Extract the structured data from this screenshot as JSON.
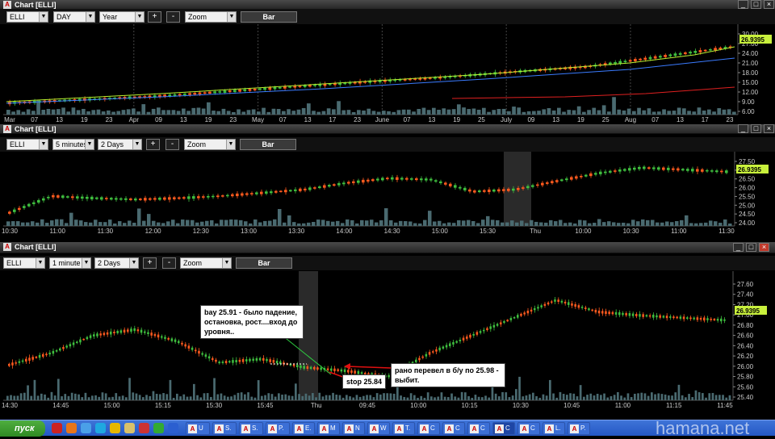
{
  "windows": [
    {
      "title": "Chart [ELLI]",
      "symbol": "ELLI",
      "interval": "DAY",
      "range": "Year",
      "zoom": "Zoom",
      "bar_label": "Bar",
      "plus": "+",
      "minus": "-",
      "price_label": "26.9395",
      "y_ticks": [
        "30.00",
        "27.00",
        "24.00",
        "21.00",
        "18.00",
        "15.00",
        "12.00",
        "9.00",
        "6.00"
      ],
      "x_ticks": [
        "Mar",
        "07",
        "13",
        "19",
        "23",
        "Apr",
        "09",
        "13",
        "19",
        "23",
        "May",
        "07",
        "13",
        "17",
        "23",
        "June",
        "07",
        "13",
        "19",
        "25",
        "July",
        "09",
        "13",
        "19",
        "25",
        "Aug",
        "07",
        "13",
        "17",
        "23"
      ]
    },
    {
      "title": "Chart [ELLI]",
      "symbol": "ELLI",
      "interval": "5 minutes",
      "range": "2 Days",
      "zoom": "Zoom",
      "bar_label": "Bar",
      "plus": "+",
      "minus": "-",
      "price_label": "26.9395",
      "y_ticks": [
        "27.50",
        "27.00",
        "26.50",
        "26.00",
        "25.50",
        "25.00",
        "24.50",
        "24.00"
      ],
      "x_ticks": [
        "10:30",
        "11:00",
        "11:30",
        "12:00",
        "12:30",
        "13:00",
        "13:30",
        "14:00",
        "14:30",
        "15:00",
        "15:30",
        "Thu",
        "10:00",
        "10:30",
        "11:00",
        "11:30"
      ]
    },
    {
      "title": "Chart [ELLI]",
      "symbol": "ELLI",
      "interval": "1 minute",
      "range": "2 Days",
      "zoom": "Zoom",
      "bar_label": "Bar",
      "plus": "+",
      "minus": "-",
      "price_label": "26.9395",
      "y_ticks": [
        "27.60",
        "27.40",
        "27.20",
        "27.00",
        "26.80",
        "26.60",
        "26.40",
        "26.20",
        "26.00",
        "25.80",
        "25.60",
        "25.40"
      ],
      "x_ticks": [
        "14:30",
        "14:45",
        "15:00",
        "15:15",
        "15:30",
        "15:45",
        "Thu",
        "09:45",
        "10:00",
        "10:15",
        "10:30",
        "10:45",
        "11:00",
        "11:15",
        "11:45"
      ]
    }
  ],
  "annotations": {
    "buy_note": "bay 25.91 - было падение, остановка, рост....вход до уровня..",
    "stop_note": "stop 25.84",
    "be_note": "рано перевел в б/у по 25.98 - выбит."
  },
  "taskbar": {
    "start": "пуск",
    "items": [
      "U",
      "S.",
      "S.",
      "P.",
      "E.",
      "M",
      "N",
      "W",
      "T.",
      "C",
      "C",
      "C",
      "C",
      "C",
      "L.",
      "P."
    ],
    "active_index": 12
  },
  "watermark": "hamana.net",
  "colors": {
    "up": "#3fbf3f",
    "down": "#ff5a1e",
    "ma_fast": "#b8f030",
    "ma_mid": "#3a7bff",
    "ma_slow": "#e02020",
    "volume": "#4a6a70",
    "price_tag": "#c8f03c"
  },
  "chart_data": [
    {
      "type": "candlestick",
      "title": "Chart [ELLI] DAY Year",
      "x_ticks": [
        "Mar",
        "Apr",
        "May",
        "June",
        "July",
        "Aug"
      ],
      "ylim": [
        6,
        30
      ],
      "last": 26.9395
    },
    {
      "type": "candlestick",
      "title": "Chart [ELLI] 5 minutes 2 Days",
      "ylim": [
        24,
        27.5
      ],
      "last": 26.9395
    },
    {
      "type": "candlestick",
      "title": "Chart [ELLI] 1 minute 2 Days",
      "ylim": [
        25.4,
        27.6
      ],
      "last": 26.9395,
      "annotations": [
        {
          "label": "bay",
          "value": 25.91
        },
        {
          "label": "stop",
          "value": 25.84
        },
        {
          "label": "б/у",
          "value": 25.98
        }
      ]
    }
  ]
}
